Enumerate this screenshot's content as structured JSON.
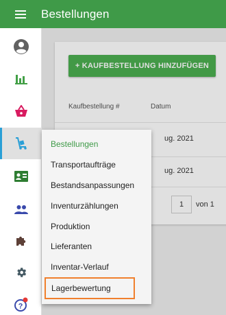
{
  "header": {
    "title": "Bestellungen",
    "menu_icon": "hamburger-menu-icon"
  },
  "sidebar": {
    "items": [
      {
        "name": "account",
        "icon": "account-circle-icon",
        "color": "#616161"
      },
      {
        "name": "reports",
        "icon": "bar-chart-icon",
        "color": "#43a047"
      },
      {
        "name": "sales",
        "icon": "basket-icon",
        "color": "#d81b60"
      },
      {
        "name": "orders",
        "icon": "trolley-icon",
        "color": "#2a9fd6",
        "active": true
      },
      {
        "name": "contacts",
        "icon": "contact-card-icon",
        "color": "#2e7d32"
      },
      {
        "name": "users",
        "icon": "people-icon",
        "color": "#3949ab"
      },
      {
        "name": "integrations",
        "icon": "puzzle-icon",
        "color": "#5d4037"
      },
      {
        "name": "settings",
        "icon": "gear-icon",
        "color": "#455a64"
      },
      {
        "name": "help",
        "icon": "help-icon",
        "color": "#3949ab",
        "badge_color": "#e53935"
      }
    ]
  },
  "main": {
    "add_button_label": "+ KAUFBESTELLUNG HINZUFÜGEN",
    "columns": [
      "Kaufbestellung #",
      "Datum"
    ],
    "rows": [
      {
        "date": "ug. 2021"
      },
      {
        "date": "ug. 2021"
      }
    ],
    "pager": {
      "page": "1",
      "of_label": "von 1"
    }
  },
  "dropdown": {
    "items": [
      {
        "label": "Bestellungen",
        "active": true
      },
      {
        "label": "Transportaufträge"
      },
      {
        "label": "Bestandsanpassungen"
      },
      {
        "label": "Inventurzählungen"
      },
      {
        "label": "Produktion"
      },
      {
        "label": "Lieferanten"
      },
      {
        "label": "Inventar-Verlauf"
      },
      {
        "label": "Lagerbewertung",
        "highlighted": true
      }
    ]
  },
  "colors": {
    "brand_green": "#3f9a48",
    "button_green": "#4caf50",
    "highlight_orange": "#f07f2c"
  }
}
